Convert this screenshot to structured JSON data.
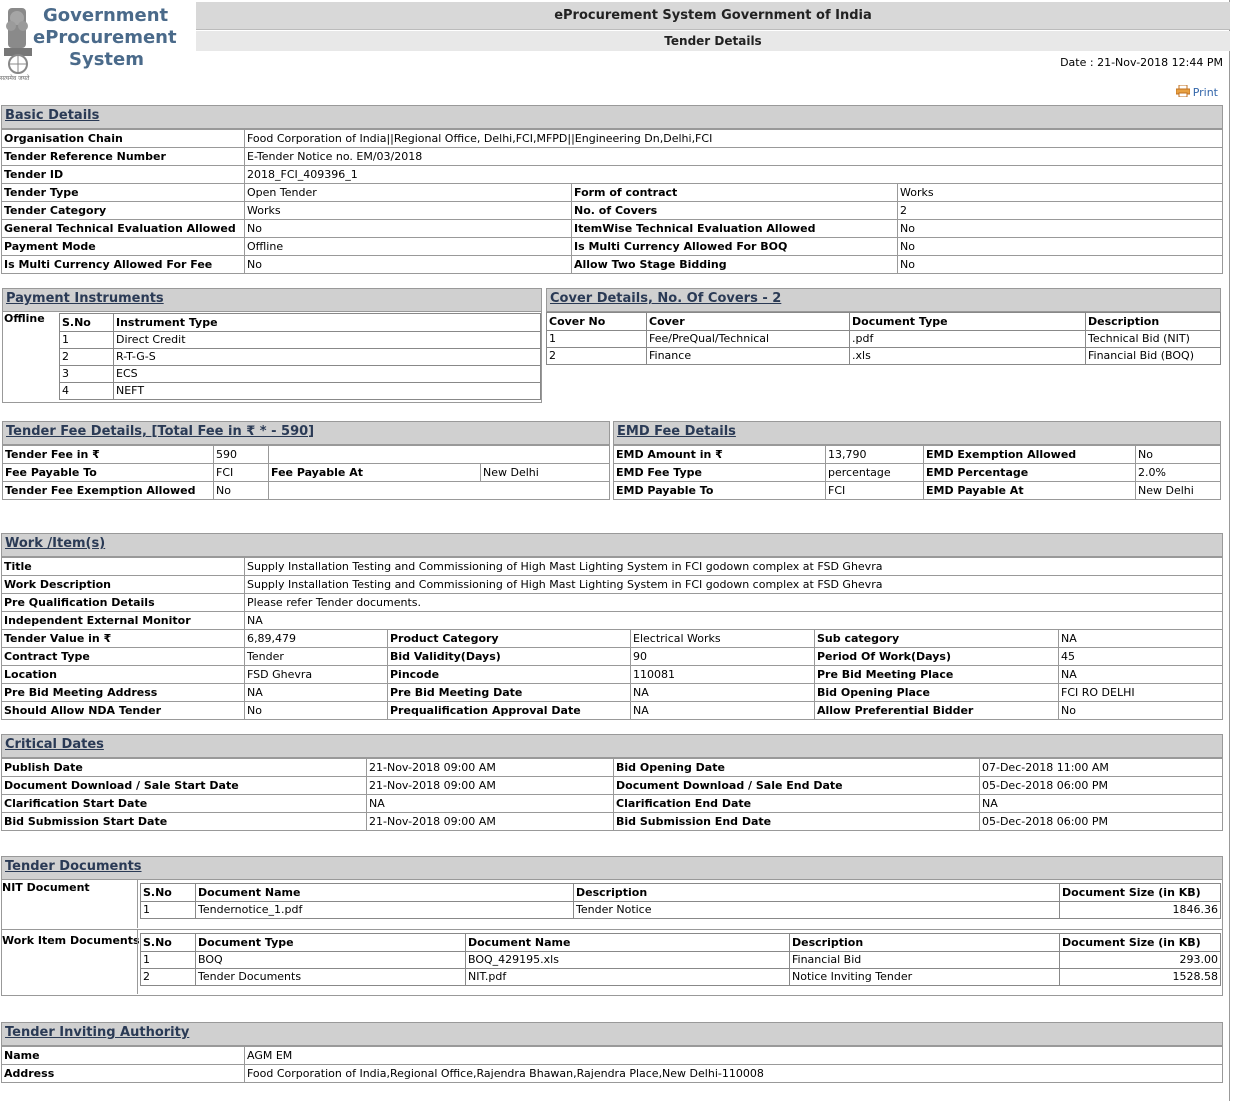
{
  "logo": {
    "line1": "Government",
    "line2": "eProcurement",
    "line3": "System",
    "emblem_caption": "सत्यमेव जयते"
  },
  "header": {
    "title": "eProcurement System Government of India",
    "subtitle": "Tender Details"
  },
  "date_line": "Date : 21-Nov-2018 12:44 PM",
  "print_label": "Print",
  "basic": {
    "title": "Basic Details",
    "org_label": "Organisation Chain",
    "org_value": "Food Corporation of India||Regional Office, Delhi,FCI,MFPD||Engineering Dn,Delhi,FCI",
    "ref_label": "Tender Reference Number",
    "ref_value": "E-Tender Notice no. EM/03/2018",
    "id_label": "Tender ID",
    "id_value": "2018_FCI_409396_1",
    "rows": [
      {
        "l1": "Tender Type",
        "v1": "Open Tender",
        "l2": "Form of contract",
        "v2": "Works"
      },
      {
        "l1": "Tender Category",
        "v1": "Works",
        "l2": "No. of Covers",
        "v2": "2"
      },
      {
        "l1": "General Technical Evaluation Allowed",
        "v1": "No",
        "l2": "ItemWise Technical Evaluation Allowed",
        "v2": "No"
      },
      {
        "l1": "Payment Mode",
        "v1": "Offline",
        "l2": "Is Multi Currency Allowed For BOQ",
        "v2": "No"
      },
      {
        "l1": "Is Multi Currency Allowed For Fee",
        "v1": "No",
        "l2": "Allow Two Stage Bidding",
        "v2": "No"
      }
    ]
  },
  "payment": {
    "title": "Payment Instruments",
    "mode": "Offline",
    "headers": [
      "S.No",
      "Instrument Type"
    ],
    "rows": [
      [
        "1",
        "Direct Credit"
      ],
      [
        "2",
        "R-T-G-S"
      ],
      [
        "3",
        "ECS"
      ],
      [
        "4",
        "NEFT"
      ]
    ]
  },
  "covers": {
    "title": "Cover Details, No. Of Covers - 2",
    "headers": [
      "Cover No",
      "Cover",
      "Document Type",
      "Description"
    ],
    "rows": [
      [
        "1",
        "Fee/PreQual/Technical",
        ".pdf",
        "Technical Bid (NIT)"
      ],
      [
        "2",
        "Finance",
        ".xls",
        "Financial Bid (BOQ)"
      ]
    ]
  },
  "fee": {
    "title": "Tender Fee Details, [Total Fee in ₹ * - 590]",
    "fee_label": "Tender Fee in ₹",
    "fee_value": "590",
    "payable_to_label": "Fee Payable To",
    "payable_to_value": "FCI",
    "payable_at_label": "Fee Payable At",
    "payable_at_value": "New Delhi",
    "exemption_label": "Tender Fee Exemption Allowed",
    "exemption_value": "No"
  },
  "emd": {
    "title": "EMD Fee Details",
    "rows": [
      {
        "l1": "EMD Amount in ₹",
        "v1": "13,790",
        "l2": "EMD Exemption Allowed",
        "v2": "No"
      },
      {
        "l1": "EMD Fee Type",
        "v1": "percentage",
        "l2": "EMD Percentage",
        "v2": "2.0%"
      },
      {
        "l1": "EMD Payable To",
        "v1": "FCI",
        "l2": "EMD Payable At",
        "v2": "New Delhi"
      }
    ]
  },
  "work": {
    "title": "Work /Item(s)",
    "title_label": "Title",
    "title_value": "Supply Installation Testing and Commissioning of High Mast Lighting System in FCI godown complex at FSD Ghevra",
    "desc_label": "Work Description",
    "desc_value": "Supply Installation Testing and Commissioning of High Mast Lighting System in FCI godown complex at FSD Ghevra",
    "preq_label": "Pre Qualification Details",
    "preq_value": "Please refer Tender documents.",
    "iem_label": "Independent External Monitor",
    "iem_value": "NA",
    "rows": [
      {
        "l1": "Tender Value in ₹",
        "v1": "6,89,479",
        "l2": "Product Category",
        "v2": "Electrical Works",
        "l3": "Sub category",
        "v3": "NA"
      },
      {
        "l1": "Contract Type",
        "v1": "Tender",
        "l2": "Bid Validity(Days)",
        "v2": "90",
        "l3": "Period Of Work(Days)",
        "v3": "45"
      },
      {
        "l1": "Location",
        "v1": "FSD Ghevra",
        "l2": "Pincode",
        "v2": "110081",
        "l3": "Pre Bid Meeting Place",
        "v3": "NA"
      },
      {
        "l1": "Pre Bid Meeting Address",
        "v1": "NA",
        "l2": "Pre Bid Meeting Date",
        "v2": "NA",
        "l3": "Bid Opening Place",
        "v3": "FCI RO DELHI"
      },
      {
        "l1": "Should Allow NDA Tender",
        "v1": "No",
        "l2": "Prequalification Approval Date",
        "v2": "NA",
        "l3": "Allow Preferential Bidder",
        "v3": "No"
      }
    ]
  },
  "dates": {
    "title": "Critical Dates",
    "rows": [
      {
        "l1": "Publish Date",
        "v1": "21-Nov-2018 09:00 AM",
        "l2": "Bid Opening Date",
        "v2": "07-Dec-2018 11:00 AM"
      },
      {
        "l1": "Document Download / Sale Start Date",
        "v1": "21-Nov-2018 09:00 AM",
        "l2": "Document Download / Sale End Date",
        "v2": "05-Dec-2018 06:00 PM"
      },
      {
        "l1": "Clarification Start Date",
        "v1": "NA",
        "l2": "Clarification End Date",
        "v2": "NA"
      },
      {
        "l1": "Bid Submission Start Date",
        "v1": "21-Nov-2018 09:00 AM",
        "l2": "Bid Submission End Date",
        "v2": "05-Dec-2018 06:00 PM"
      }
    ]
  },
  "docs": {
    "title": "Tender Documents",
    "nit_label": "NIT Document",
    "nit_headers": [
      "S.No",
      "Document Name",
      "Description",
      "Document Size (in KB)"
    ],
    "nit_rows": [
      [
        "1",
        "Tendernotice_1.pdf",
        "Tender Notice",
        "1846.36"
      ]
    ],
    "work_label": "Work Item Documents",
    "work_headers": [
      "S.No",
      "Document Type",
      "Document Name",
      "Description",
      "Document Size (in KB)"
    ],
    "work_rows": [
      [
        "1",
        "BOQ",
        "BOQ_429195.xls",
        "Financial Bid",
        "293.00"
      ],
      [
        "2",
        "Tender Documents",
        "NIT.pdf",
        "Notice Inviting Tender",
        "1528.58"
      ]
    ]
  },
  "authority": {
    "title": "Tender Inviting Authority",
    "name_label": "Name",
    "name_value": "AGM EM",
    "addr_label": "Address",
    "addr_value": "Food Corporation of India,Regional Office,Rajendra Bhawan,Rajendra Place,New Delhi-110008"
  }
}
